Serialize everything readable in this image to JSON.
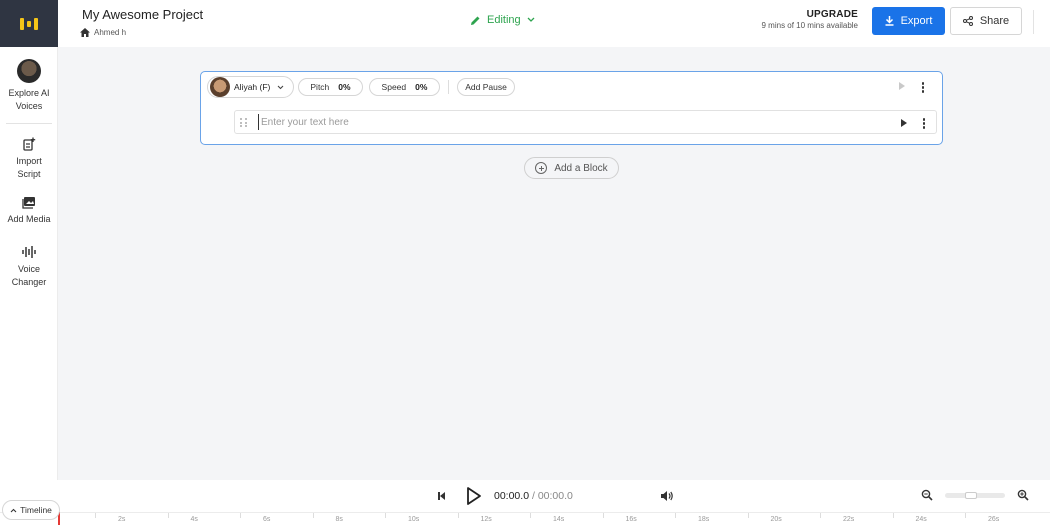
{
  "header": {
    "project_title": "My Awesome Project",
    "breadcrumb": "Ahmed h",
    "mode": "Editing",
    "upgrade_title": "UPGRADE",
    "upgrade_sub": "9 mins of 10 mins available",
    "export_label": "Export",
    "share_label": "Share"
  },
  "sidebar": {
    "items": [
      {
        "label": "Explore AI\nVoices",
        "icon": "voice-avatar"
      },
      {
        "label": "Import\nScript",
        "icon": "import-icon"
      },
      {
        "label": "Add Media",
        "icon": "media-icon"
      },
      {
        "label": "Voice\nChanger",
        "icon": "waveform-icon"
      }
    ]
  },
  "block": {
    "voice": "Aliyah (F)",
    "pitch_label": "Pitch",
    "pitch_value": "0%",
    "speed_label": "Speed",
    "speed_value": "0%",
    "add_pause": "Add Pause",
    "text_placeholder": "Enter your text here",
    "text_value": ""
  },
  "add_block_label": "Add a Block",
  "player": {
    "timeline_label": "Timeline",
    "time_current": "00:00.0",
    "time_separator": "/",
    "time_total": "00:00.0"
  },
  "ruler": {
    "labels": [
      "2s",
      "4s",
      "6s",
      "8s",
      "10s",
      "12s",
      "14s",
      "16s",
      "18s",
      "20s",
      "22s",
      "24s",
      "26s"
    ]
  },
  "colors": {
    "brand_dark": "#2f3542",
    "logo_yellow": "#f5c518",
    "accent_blue": "#1a73e8",
    "editing_green": "#2ea44f",
    "playhead_red": "#e53935"
  }
}
